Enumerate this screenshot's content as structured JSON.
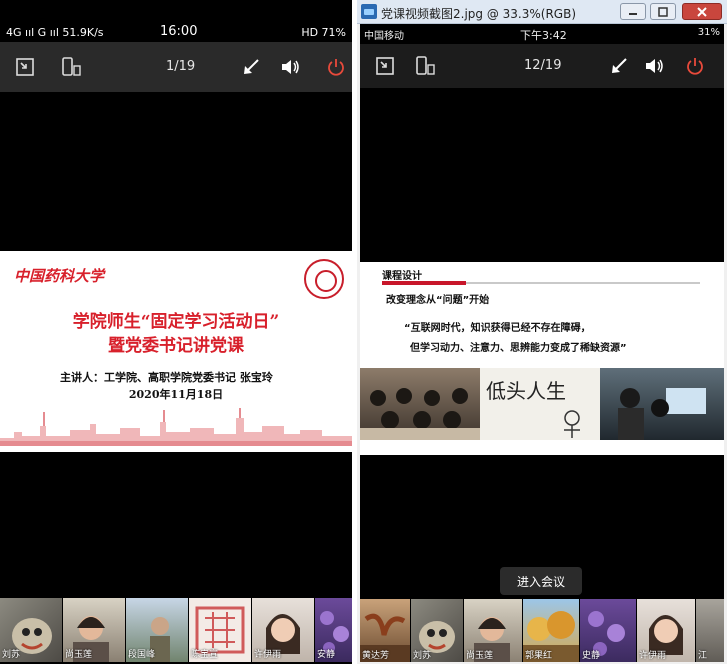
{
  "left": {
    "status": {
      "left": "4G ııl G ııl 51.9K/s",
      "time": "16:00",
      "right": "HD 71%"
    },
    "toolbar": {
      "page": "1/19"
    },
    "slide": {
      "logo": "中国药科大学",
      "title_line1": "学院师生“固定学习活动日”",
      "title_line2": "暨党委书记讲党课",
      "speaker": "主讲人：工学院、高职学院党委书记 张宝玲",
      "date": "2020年11月18日"
    },
    "participants": [
      "刘苏",
      "尚玉莲",
      "段国峰",
      "陈宝宣",
      "许伊雨",
      "安静"
    ]
  },
  "right": {
    "window_title": "党课视频截图2.jpg @ 33.3%(RGB)",
    "status": {
      "carrier": "中国移动",
      "time": "下午3:42",
      "battery": "31%"
    },
    "toolbar": {
      "page": "12/19"
    },
    "slide": {
      "heading": "课程设计",
      "subheading": "改变理念从“问题”开始",
      "quote_line1": "“互联网时代，知识获得已经不存在障碍，",
      "quote_line2": "但学习动力、注意力、思辨能力变成了稀缺资源”",
      "image_caption": "低头人生"
    },
    "join_button": "进入会议",
    "participants": [
      "黄达芳",
      "刘苏",
      "尚玉莲",
      "郭果红",
      "史静",
      "许伊雨",
      "江"
    ]
  },
  "colors": {
    "accent_red": "#d8202b",
    "toolbar_bg": "#2a2a2a",
    "power_red": "#e84a3b"
  }
}
